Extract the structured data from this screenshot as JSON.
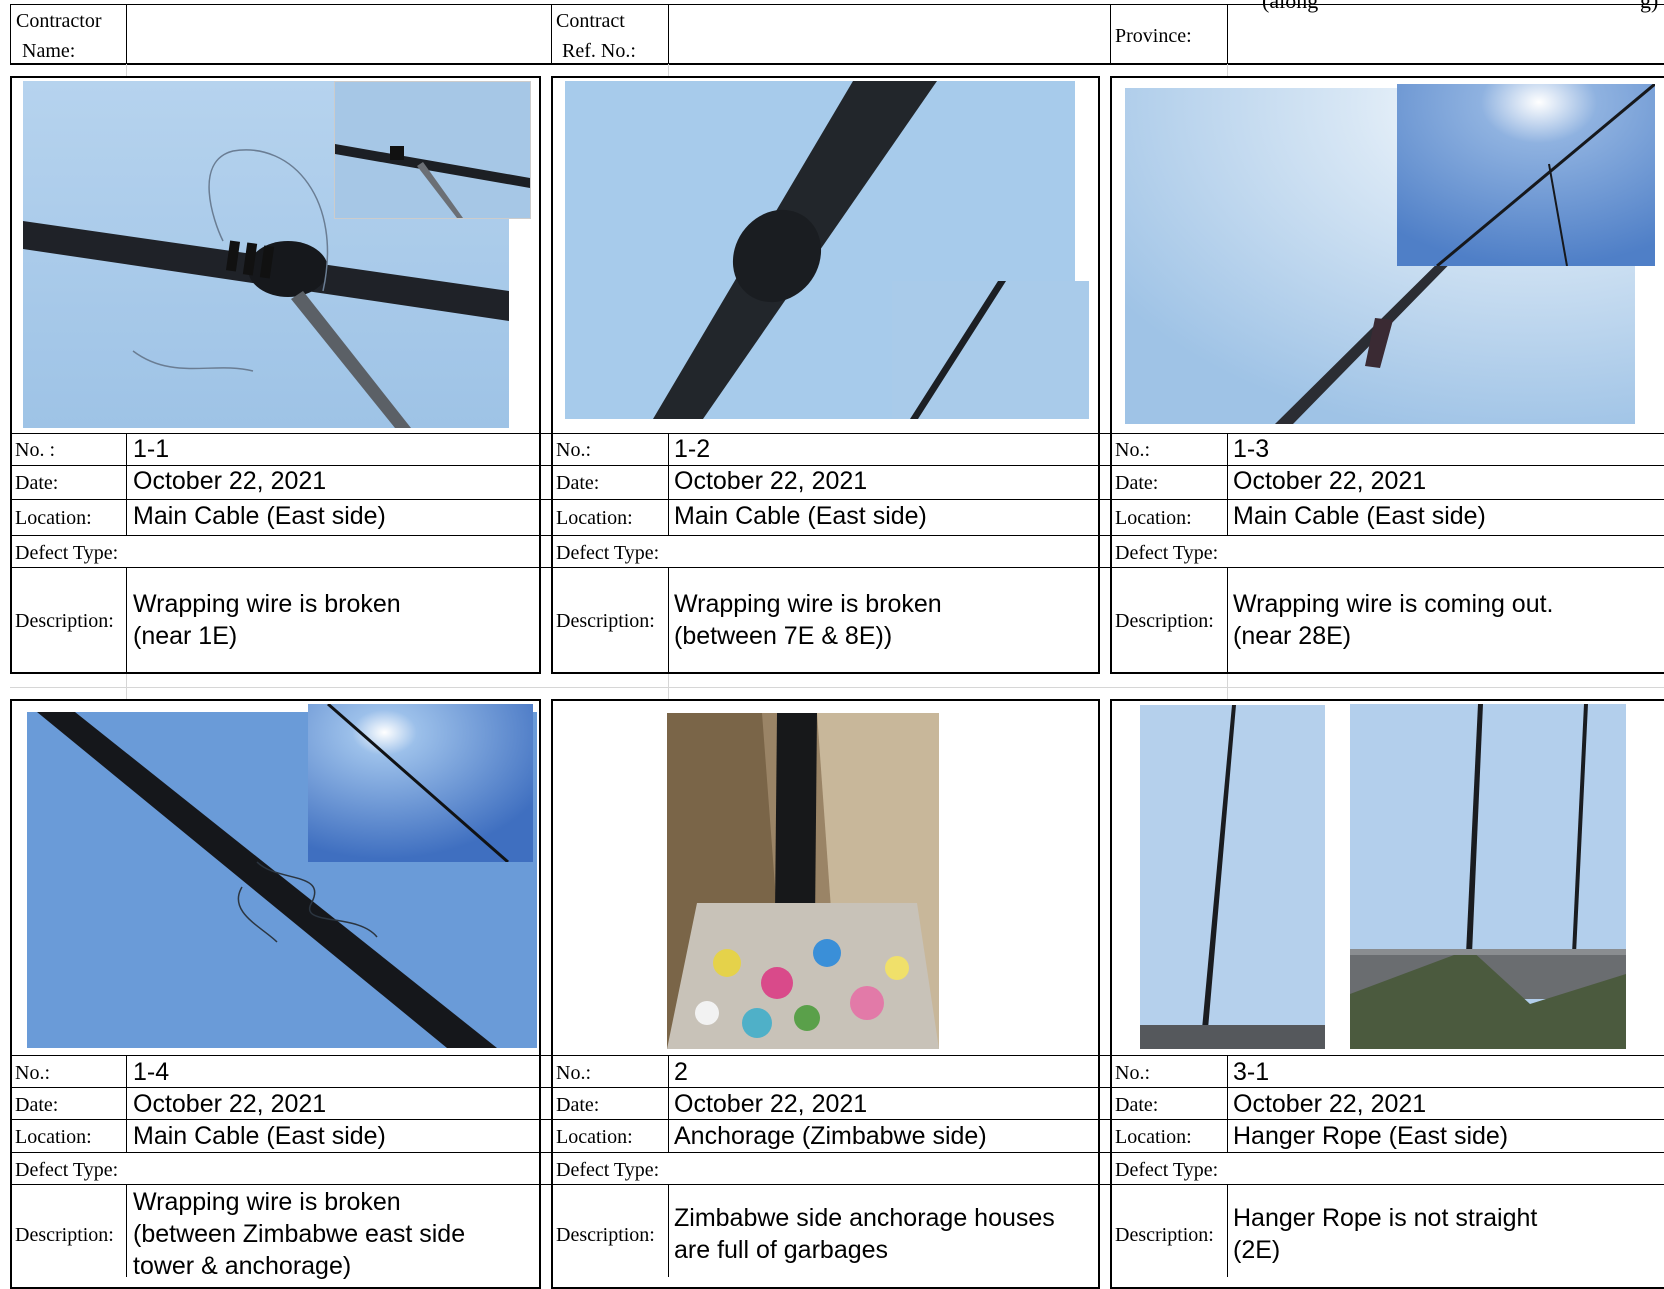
{
  "header": {
    "top_right_fragment": "(along",
    "top_right_fragment2": "g)",
    "contractor_label_line1": "Contractor",
    "contractor_label_line2": "Name:",
    "contract_label_line1": "Contract",
    "contract_label_line2": "Ref. No.:",
    "province_label": "Province:"
  },
  "labels": {
    "no_first": "No. :",
    "no": "No.:",
    "date": "Date:",
    "location": "Location:",
    "defect_type": "Defect Type:",
    "description": "Description:"
  },
  "cards": [
    {
      "no": "1-1",
      "date": "October 22, 2021",
      "location": "Main Cable (East side)",
      "description": "Wrapping wire is broken\n(near 1E)"
    },
    {
      "no": "1-2",
      "date": "October 22, 2021",
      "location": "Main Cable (East side)",
      "description": "Wrapping wire is broken\n(between 7E & 8E))"
    },
    {
      "no": "1-3",
      "date": "October 22, 2021",
      "location": "Main Cable (East side)",
      "description": "Wrapping wire is coming out.\n(near 28E)"
    },
    {
      "no": "1-4",
      "date": "October 22, 2021",
      "location": "Main Cable (East side)",
      "description": "Wrapping wire is broken\n(between Zimbabwe east side\ntower & anchorage)"
    },
    {
      "no": "2",
      "date": "October 22, 2021",
      "location": "Anchorage (Zimbabwe side)",
      "description": "Zimbabwe side anchorage houses\nare full of garbages"
    },
    {
      "no": "3-1",
      "date": "October 22, 2021",
      "location": "Hanger Rope (East side)",
      "description": "Hanger Rope is not straight\n(2E)"
    }
  ],
  "colors": {
    "sky": "#a9cbea",
    "sky_deep": "#5f8fd0",
    "cable": "#1c1f24",
    "concrete": "#b7a58a"
  }
}
